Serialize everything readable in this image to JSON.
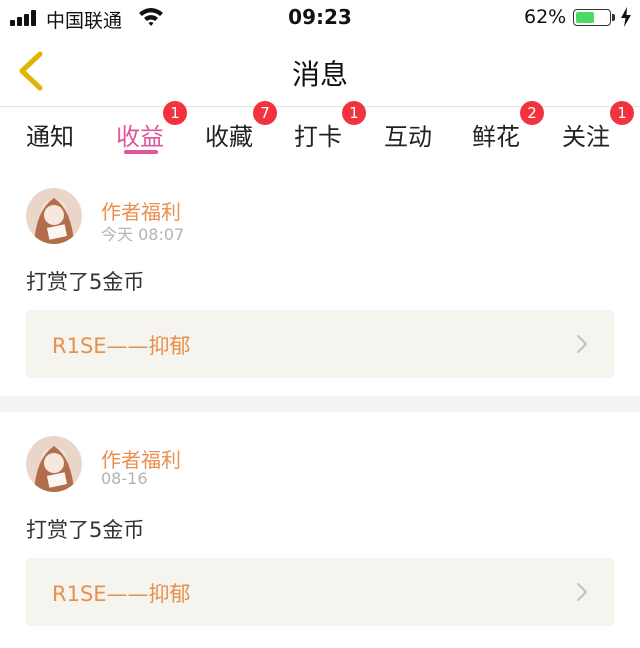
{
  "status_bar": {
    "carrier": "中国联通",
    "time": "09:23",
    "battery_percent": "62%",
    "battery_level": 0.62,
    "battery_color": "#4cd964"
  },
  "nav": {
    "title": "消息",
    "back_icon": "chevron-left-icon",
    "back_color": "#e0b400"
  },
  "tabs": [
    {
      "label": "通知",
      "badge": ""
    },
    {
      "label": "收益",
      "badge": "1",
      "active": true
    },
    {
      "label": "收藏",
      "badge": "7"
    },
    {
      "label": "打卡",
      "badge": "1"
    },
    {
      "label": "互动",
      "badge": ""
    },
    {
      "label": "鲜花",
      "badge": "2"
    },
    {
      "label": "关注",
      "badge": "1"
    }
  ],
  "accent_color": "#e0569b",
  "badge_color": "#f0333e",
  "messages": [
    {
      "author": "作者福利",
      "time": "今天 08:07",
      "text": "打赏了5金币",
      "link_title": "R1SE——抑郁"
    },
    {
      "author": "作者福利",
      "time": "08-16",
      "text": "打赏了5金币",
      "link_title": "R1SE——抑郁"
    }
  ]
}
